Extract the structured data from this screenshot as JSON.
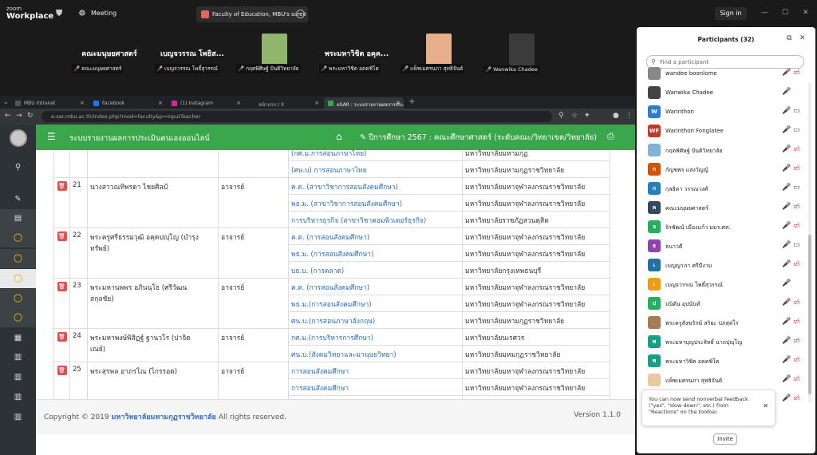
{
  "topbar": {
    "brand_small": "zoom",
    "brand_big": "Workplace",
    "meeting_label": "Meeting",
    "share_title": "Faculty of Education, MBU's scree",
    "signin": "Sign in"
  },
  "strip": [
    {
      "name": "คณะมนุษยศาสตร์",
      "label": "คณะมนุษยศาสตร์"
    },
    {
      "name": "เบญจวรรณ โพธิส...",
      "label": "เบญจวรรณ โพธิ์สุวรรณ์"
    },
    {
      "name": "",
      "label": "กฤตพิศิษฐ์ ปันติวิทยาลัย"
    },
    {
      "name": "พระมหาวิชิต อคุค...",
      "label": "พระมหาวิชิต อคคชิโต"
    },
    {
      "name": "",
      "label": "แพ็ชเมศรนภา สุทธิจันต์"
    },
    {
      "name": "",
      "label": "Wanwika Chadee"
    }
  ],
  "browser": {
    "tabs": [
      {
        "label": "MBU Intranet",
        "color": "#555"
      },
      {
        "label": "Facebook",
        "color": "#1877f2"
      },
      {
        "label": "(1) Instagram",
        "color": "#d6249f"
      },
      {
        "label": "หน้าแรก / X",
        "color": "#222"
      },
      {
        "label": "eSAR : ระบบรายงานผลการประเมินตน...",
        "color": "#3aa64b"
      }
    ],
    "url": "e-sar.mbu.ac.th/index.php?mod=faculty&p=inputTeacher"
  },
  "app": {
    "title": "ระบบรายงานผลการประเมินตนเองออนไลน์",
    "year": "ปีการศึกษา 2567 : คณะศึกษาศาสตร์ (ระดับคณะ/วิทยาเขต/วิทยาลัย)",
    "rows": [
      {
        "no": "",
        "name": "",
        "pos": "",
        "rec": [
          [
            "(กศ.ม.การสอนภาษาไทย)",
            "มหาวิทยาลัยมหามกุฏ"
          ],
          [
            "(ศษ.บ) การสอนภาษาไทย",
            "มหาวิทยาลัยมหามกุฏราชวิทยาลัย"
          ]
        ]
      },
      {
        "no": "21",
        "name": "นางสาวณทิพรดา ไชยศิลป์",
        "pos": "อาจารย์",
        "rec": [
          [
            "ค.ด. (สาขาวิชาการสอนสังคมศึกษา)",
            "มหาวิทยาลัยมหาจุฬาลงกรณราชวิทยาลัย"
          ],
          [
            "พธ.ม. (สาขาวิชาการสอนสังคมศึกษา)",
            "มหาวิทยาลัยมหาจุฬาลงกรณราชวิทยาลัย"
          ],
          [
            "การบริหารธุรกิจ (สาขาวิชาคอมพิวเตอร์ธุรกิจ)",
            "มหาวิทยาลัยราชภัฏสวนดุสิต"
          ]
        ]
      },
      {
        "no": "22",
        "name": "พระครูศรีธรรมวุฒิ อคฺคปญฺโญ (บำรุง",
        "name2": "ทรัพย์)",
        "pos": "อาจารย์",
        "rec": [
          [
            "ค.ด. (การสอนสังคมศึกษา)",
            "มหาวิทยาลัยมหาจุฬาลงกรณราชวิทยาลัย"
          ],
          [
            "พธ.ม. (การสอนสังคมศึกษา)",
            "มหาวิทยาลัยมหาจุฬาลงกรณราชวิทยาลัย"
          ],
          [
            "บธ.บ. (การตลาด)",
            "มหาวิทยาลัยกรุงเทพธนบุรี"
          ]
        ]
      },
      {
        "no": "23",
        "name": "พระมหานพพร อภินนฺโธ (ศรีวัฒน",
        "name2": "สกุลชัย)",
        "pos": "อาจารย์",
        "rec": [
          [
            "ค.ด. (การสอนสังคมศึกษา)",
            "มหาวิทยาลัยมหาจุฬาลงกรณราชวิทยาลัย"
          ],
          [
            "พธ.ม.(การสอนสังคมศึกษา)",
            "มหาวิทยาลัยมหาจุฬาลงกรณราชวิทยาลัย"
          ],
          [
            "ศน.บ.(การสอนภาษาอังกฤษ)",
            "มหาวิทยาลัยมหามกุฏราชวิทยาลัย"
          ]
        ]
      },
      {
        "no": "24",
        "name": "พระมหาพงษ์พิสิฏฐ์ ฐานวโร (ปาจิต",
        "name2": "เณย์)",
        "pos": "อาจารย์",
        "rec": [
          [
            "กศ.ม.(การบริหารการศึกษา)",
            "มหาวิทยาลัยนเรศวร"
          ],
          [
            "ศน.บ.(สังคมวิทยาและมานุษยวิทยา)",
            "มหาวิทยาลัยมหมกุฏราชวิทยาลัย"
          ]
        ]
      },
      {
        "no": "25",
        "name": "พระสุรพล อาภรโณ (ไกรรอด)",
        "pos": "อาจารย์",
        "rec": [
          [
            "การสอนสังคมศึกษา",
            "มหาวิทยาลัยมหาจุฬาลงกรณราชวิทยาลัย"
          ],
          [
            "การสอนสังคมศึกษา",
            "มหาวิทยาลัยมหาจุฬาลงกรณราชวิทยาลัย"
          ],
          [
            "การสอนภาษาอังกฤษ",
            "มหาวิทยาลัยมหามกุฏราชวิทยาลัย"
          ]
        ]
      }
    ],
    "footer": {
      "copy_pre": "Copyright © 2019",
      "copy_org": "มหาวิทยาลัยมหามกุฏราชวิทยาลัย",
      "copy_post": "All rights reserved.",
      "version": "Version 1.1.0"
    }
  },
  "panel": {
    "title": "Participants (32)",
    "search_placeholder": "Find a participant",
    "people": [
      {
        "name": "wandee boonlome",
        "av": "",
        "color": "#888",
        "cam": "off"
      },
      {
        "name": "Wanwika Chadee",
        "av": "",
        "color": "#444",
        "cam": "none"
      },
      {
        "name": "Warinthon",
        "av": "W",
        "color": "#2d7bd0",
        "cam": "on"
      },
      {
        "name": "Warinthon Fonglatee",
        "av": "WF",
        "color": "#c0392b",
        "cam": "on"
      },
      {
        "name": "กฤตพิศิษฐ์ ปันติวิทยาลัย",
        "av": "",
        "color": "#7fb3d5",
        "cam": "off"
      },
      {
        "name": "กัญชพร แสงวัญญ์",
        "av": "ก",
        "color": "#d35400",
        "cam": "off"
      },
      {
        "name": "กุลธิดา วรรณวงศ์",
        "av": "ก",
        "color": "#2980b9",
        "cam": "on"
      },
      {
        "name": "คณะมนุษยศาสตร์",
        "av": "ค",
        "color": "#34495e",
        "cam": "off"
      },
      {
        "name": "จิรพัฒน์ เมืองแก้ว มมร.ศส.",
        "av": "จ",
        "color": "#27ae60",
        "cam": "off"
      },
      {
        "name": "ธนาวดี",
        "av": "ธ",
        "color": "#8e44ad",
        "cam": "on"
      },
      {
        "name": "เบญญาภา ศรีมีงาม",
        "av": "เ",
        "color": "#2471a3",
        "cam": "off"
      },
      {
        "name": "เบญจวรรณ โพธิ์สุวรรณ์",
        "av": "เ",
        "color": "#f39c12",
        "cam": "none"
      },
      {
        "name": "ปนิตัน อุปนันท์",
        "av": "ป",
        "color": "#27ae60",
        "cam": "off"
      },
      {
        "name": "พระครูสังฆรักษ์ สริยะ ปภสฺสโร",
        "av": "",
        "color": "#a67c52",
        "cam": "off"
      },
      {
        "name": "พระมหาบุญประสิทธิ์ นาถปุญฺโญ",
        "av": "พ",
        "color": "#16a085",
        "cam": "off"
      },
      {
        "name": "พระมหาวิชิต อคคชิโต",
        "av": "พ",
        "color": "#16a085",
        "cam": "off"
      },
      {
        "name": "แพ็ชเมศรนภา สุทธิจันต์",
        "av": "",
        "color": "#e8c9a0",
        "cam": "off"
      },
      {
        "name": "",
        "av": "",
        "color": "#fff",
        "cam": "off"
      },
      {
        "name": "",
        "av": "",
        "color": "#fff",
        "cam": "off"
      }
    ],
    "toast": "You can now send nonverbal feedback (\"yes\", \"slow down\", etc.) from \"Reactions\" on the toolbar.",
    "invite": "Invite"
  }
}
